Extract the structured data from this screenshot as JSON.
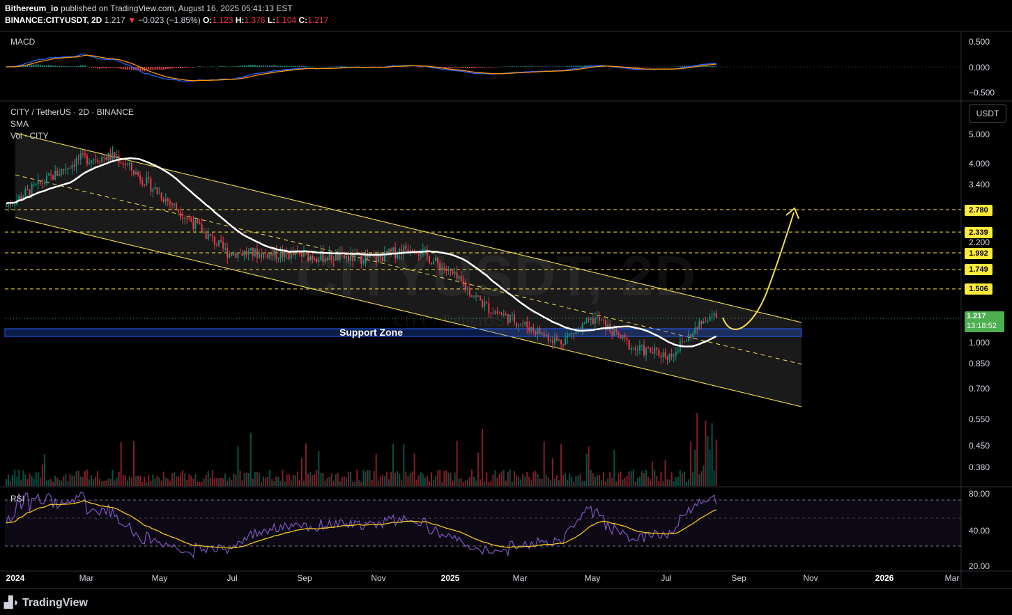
{
  "header": {
    "publisher": "Bithereum_io",
    "published_text": "published on TradingView.com, August 16, 2025 05:41:13 EST",
    "symbol_line": "BINANCE:CITYUSDT, 2D",
    "last": "1.217",
    "change": "−0.023 (−1.85%)",
    "o_label": "O:",
    "o": "1.123",
    "h_label": "H:",
    "h": "1.376",
    "l_label": "L:",
    "l": "1.104",
    "c_label": "C:",
    "c": "1.217"
  },
  "panes": {
    "macd_title": "MACD",
    "main_title": "CITY / TetherUS · 2D · BINANCE",
    "sma_label": "SMA",
    "vol_label": "Vol · CITY",
    "rsi_title": "RSI",
    "currency_button": "USDT",
    "support_label": "Support Zone",
    "watermark": "CITYUSDT, 2D",
    "watermark_sub": "CITY / TetherUS"
  },
  "macd_axis": [
    "0.500",
    "0.000",
    "−0.500"
  ],
  "price_axis": [
    "5.000",
    "4.000",
    "3.400",
    "2.200",
    "1.000",
    "0.850",
    "0.700",
    "0.550",
    "0.450",
    "0.380"
  ],
  "rsi_axis": [
    "80.00",
    "40.00",
    "20.00"
  ],
  "level_tags": [
    "2.780",
    "2.339",
    "1.992",
    "1.749",
    "1.506"
  ],
  "price_tag": {
    "price": "1.217",
    "countdown": "13:18:52"
  },
  "x_axis": [
    "2024",
    "Mar",
    "May",
    "Jul",
    "Sep",
    "Nov",
    "2025",
    "Mar",
    "May",
    "Jul",
    "Sep",
    "Nov",
    "2026",
    "Mar"
  ],
  "footer": {
    "brand": "TradingView"
  },
  "colors": {
    "up": "#089981",
    "down": "#f23645",
    "channel": "#f5e050",
    "level_tag": "#ffeb3b",
    "price_tag": "#4caf50",
    "sma": "#ffffff",
    "rsi": "#7e57c2",
    "rsi_ma": "#f5c518"
  },
  "chart_data": {
    "type": "candlestick",
    "symbol": "CITY / TetherUS",
    "interval": "2D",
    "horizontal_levels": [
      2.78,
      2.339,
      1.992,
      1.749,
      1.506
    ],
    "last_price": 1.217,
    "ohlc_last": {
      "open": 1.123,
      "high": 1.376,
      "low": 1.104,
      "close": 1.217
    },
    "approx_close_path": [
      {
        "x": "2024-01",
        "y": 2.85
      },
      {
        "x": "2024-03",
        "y": 4.1
      },
      {
        "x": "2024-04",
        "y": 4.2
      },
      {
        "x": "2024-05",
        "y": 3.3
      },
      {
        "x": "2024-07",
        "y": 2.0
      },
      {
        "x": "2024-09",
        "y": 1.95
      },
      {
        "x": "2024-11",
        "y": 1.9
      },
      {
        "x": "2024-12",
        "y": 2.1
      },
      {
        "x": "2025-01",
        "y": 1.7
      },
      {
        "x": "2025-02",
        "y": 1.3
      },
      {
        "x": "2025-03",
        "y": 1.15
      },
      {
        "x": "2025-04",
        "y": 1.0
      },
      {
        "x": "2025-05",
        "y": 1.2
      },
      {
        "x": "2025-06",
        "y": 0.95
      },
      {
        "x": "2025-07",
        "y": 0.9
      },
      {
        "x": "2025-08",
        "y": 1.217
      }
    ],
    "y_scale": "log",
    "macd_range": [
      -0.5,
      0.5
    ],
    "rsi_range": [
      20,
      80
    ]
  }
}
